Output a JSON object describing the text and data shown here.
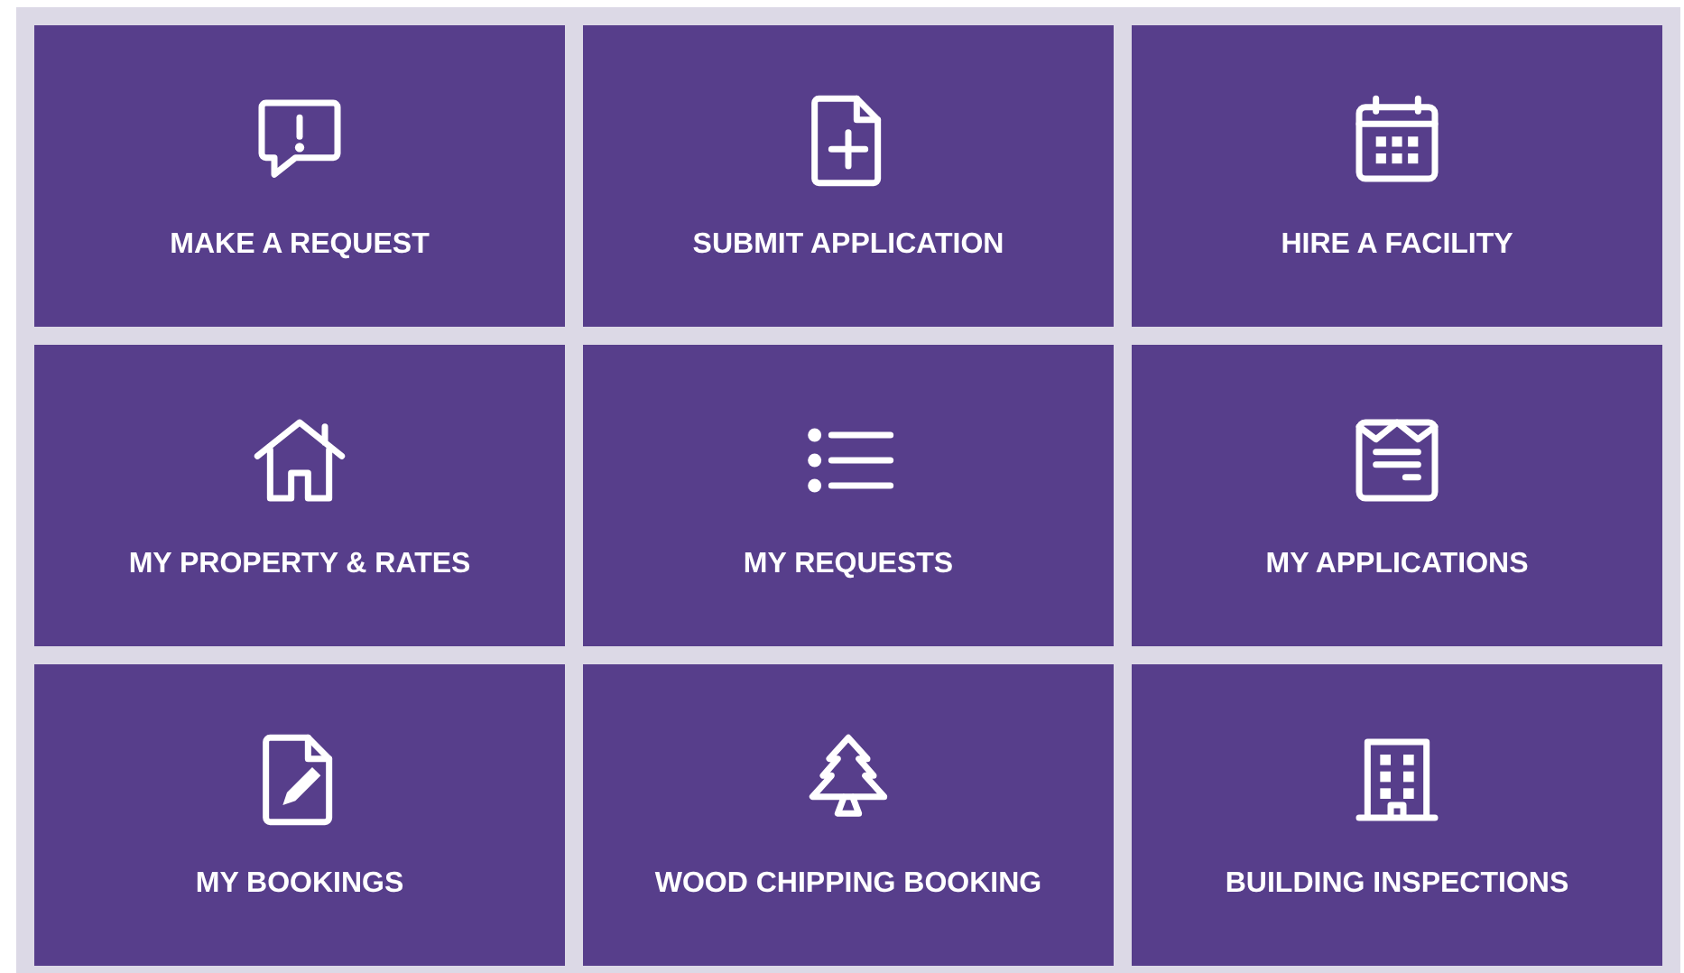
{
  "tiles": [
    {
      "label": "MAKE A REQUEST"
    },
    {
      "label": "SUBMIT APPLICATION"
    },
    {
      "label": "HIRE A FACILITY"
    },
    {
      "label": "MY PROPERTY & RATES"
    },
    {
      "label": "MY REQUESTS"
    },
    {
      "label": "MY APPLICATIONS"
    },
    {
      "label": "MY BOOKINGS"
    },
    {
      "label": "WOOD CHIPPING BOOKING"
    },
    {
      "label": "BUILDING INSPECTIONS"
    }
  ]
}
